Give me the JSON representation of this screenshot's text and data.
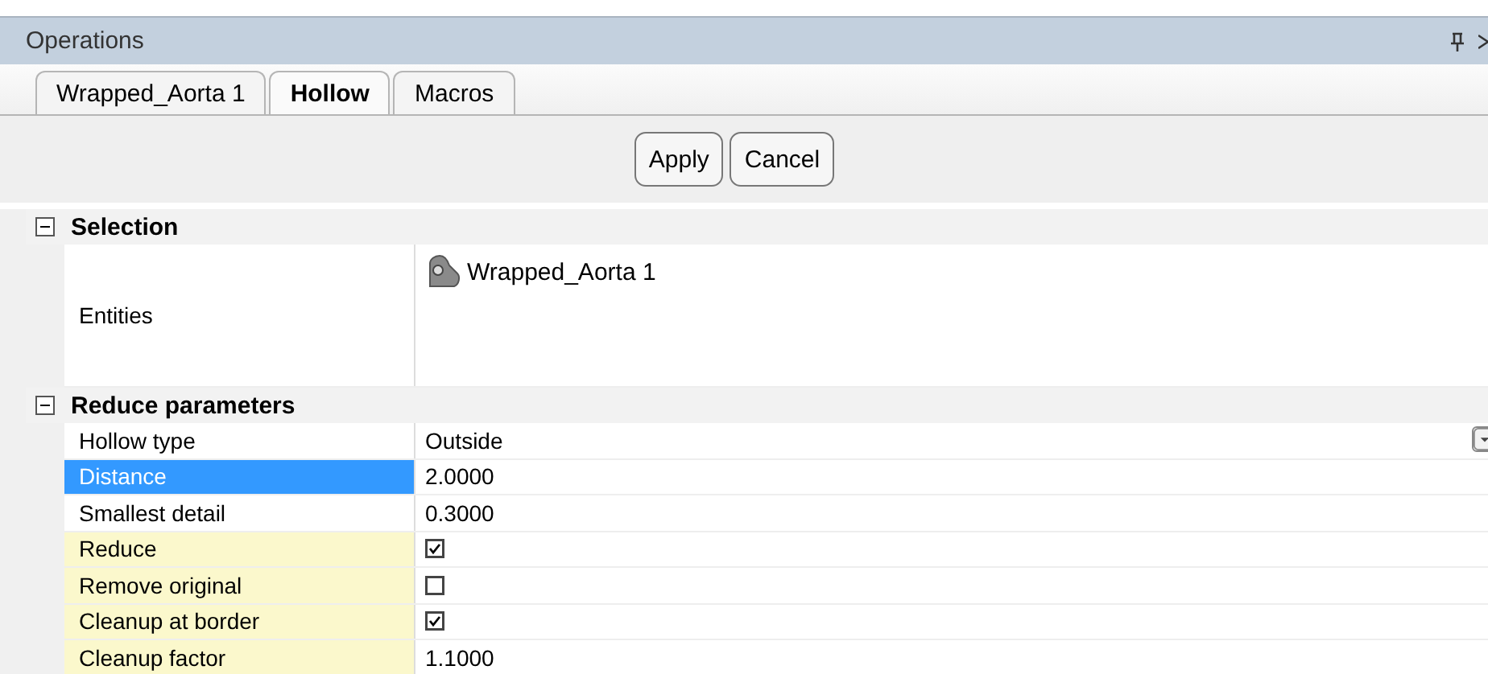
{
  "window": {
    "title": "Operations"
  },
  "tabs": [
    {
      "label": "Wrapped_Aorta 1",
      "selected": false
    },
    {
      "label": "Hollow",
      "selected": true
    },
    {
      "label": "Macros",
      "selected": false
    }
  ],
  "buttons": [
    "Apply",
    "Cancel"
  ],
  "categories": [
    {
      "title": "Selection",
      "expanded": true,
      "rows": [
        {
          "label": "Entities",
          "kind": "entity",
          "value": "Wrapped_Aorta 1",
          "selected": false,
          "highlighted": false
        }
      ]
    },
    {
      "title": "Reduce parameters",
      "expanded": true,
      "rows": [
        {
          "label": "Hollow type",
          "kind": "dropdown",
          "value": "Outside",
          "selected": false,
          "highlighted": false
        },
        {
          "label": "Distance",
          "kind": "text",
          "value": "2.0000",
          "selected": true,
          "highlighted": false
        },
        {
          "label": "Smallest detail",
          "kind": "text",
          "value": "0.3000",
          "selected": false,
          "highlighted": false
        },
        {
          "label": "Reduce",
          "kind": "checkbox",
          "checked": true,
          "selected": false,
          "highlighted": true
        },
        {
          "label": "Remove original",
          "kind": "checkbox",
          "checked": false,
          "selected": false,
          "highlighted": true
        },
        {
          "label": "Cleanup at border",
          "kind": "checkbox",
          "checked": true,
          "selected": false,
          "highlighted": true
        },
        {
          "label": "Cleanup factor",
          "kind": "text",
          "value": "1.1000",
          "selected": false,
          "highlighted": true
        }
      ]
    }
  ]
}
